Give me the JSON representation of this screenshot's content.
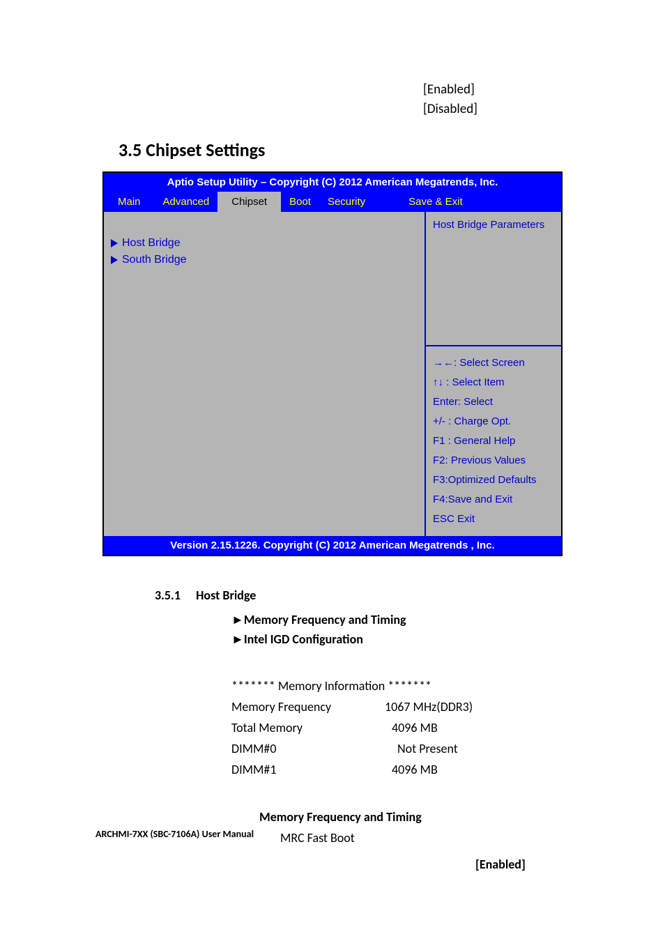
{
  "top_options": {
    "opt1": "[Enabled]",
    "opt2": "[Disabled]"
  },
  "section_heading": "3.5 Chipset Settings",
  "bios": {
    "header": "Aptio Setup Utility – Copyright (C) 2012 American Megatrends, Inc.",
    "tabs": {
      "main": "Main",
      "advanced": "Advanced",
      "chipset": "Chipset",
      "boot": "Boot",
      "security": "Security",
      "save_exit": "Save & Exit"
    },
    "left_menu": {
      "item1": "Host Bridge",
      "item2": "South Bridge"
    },
    "right_top": "Host Bridge Parameters",
    "help": {
      "l1": "→←: Select Screen",
      "l2": "↑↓    : Select Item",
      "l3": "Enter:    Select",
      "l4": "+/- : Charge Opt.",
      "l5": "F1 : General Help",
      "l6": "F2: Previous Values",
      "l7": "F3:Optimized Defaults",
      "l8": "F4:Save and Exit",
      "l9": "ESC    Exit"
    },
    "footer": "Version 2.15.1226. Copyright (C) 2012 American Megatrends , Inc."
  },
  "subsection": {
    "num": "3.5.1",
    "title": "Host Bridge",
    "items": {
      "i1": "Memory Frequency and Timing",
      "i2": "Intel IGD Configuration"
    }
  },
  "mem_info": {
    "header": "******* Memory Information *******",
    "r1_label": "Memory Frequency",
    "r1_val": "1067 MHz(DDR3)",
    "r2_label": "Total Memory",
    "r2_val": "4096 MB",
    "r3_label": "DIMM#0",
    "r3_val": "Not Present",
    "r4_label": "DIMM#1",
    "r4_val": "4096 MB"
  },
  "mrc": {
    "title": "Memory Frequency and Timing",
    "item": "MRC Fast Boot",
    "enabled": "[Enabled]"
  },
  "footer_label": "ARCHMI-7XX (SBC-7106A) User Manual"
}
